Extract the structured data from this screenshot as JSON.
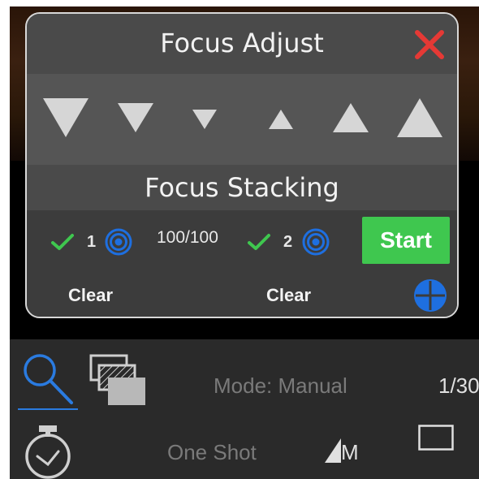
{
  "focus_adjust": {
    "title": "Focus Adjust",
    "close_icon": "close-x-icon",
    "close_color": "#e53935",
    "steps": [
      {
        "icon": "triangle-down-large-icon",
        "direction": "near",
        "size": "large"
      },
      {
        "icon": "triangle-down-medium-icon",
        "direction": "near",
        "size": "medium"
      },
      {
        "icon": "triangle-down-small-icon",
        "direction": "near",
        "size": "small"
      },
      {
        "icon": "triangle-up-small-icon",
        "direction": "far",
        "size": "small"
      },
      {
        "icon": "triangle-up-medium-icon",
        "direction": "far",
        "size": "medium"
      },
      {
        "icon": "triangle-up-large-icon",
        "direction": "far",
        "size": "large"
      }
    ]
  },
  "focus_stacking": {
    "title": "Focus Stacking",
    "point1": {
      "check_icon": "checkmark-icon",
      "number": "1",
      "target_icon": "focus-target-icon",
      "clear_label": "Clear"
    },
    "point2": {
      "check_icon": "checkmark-icon",
      "number": "2",
      "target_icon": "focus-target-icon",
      "clear_label": "Clear"
    },
    "counter": "100/100",
    "start_label": "Start",
    "add_icon": "add-crosshair-icon",
    "colors": {
      "check": "#3fc74f",
      "target": "#1e6fe0",
      "start": "#3fc74f"
    }
  },
  "toolbar": {
    "zoom_icon": "magnifier-icon",
    "bracket_icon": "layered-frames-icon",
    "mode_text": "Mode: Manual",
    "shutter_text": "1/30",
    "timer_icon": "stopwatch-icon",
    "drive_text": "One Shot",
    "size_label": "M",
    "size_icon": "image-size-icon",
    "aspect_icon": "aspect-frame-icon",
    "accent": "#2a7be0"
  }
}
